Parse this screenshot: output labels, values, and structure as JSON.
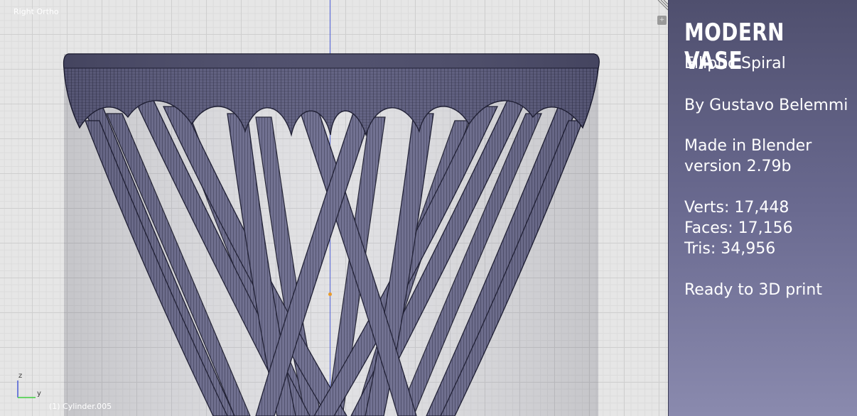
{
  "viewport": {
    "view_name": "Right Ortho",
    "object_name": "(1) Cylinder.005",
    "axis_labels": {
      "z": "z",
      "y": "y"
    }
  },
  "info": {
    "title": "MODERN VASE",
    "subtitle": "Elliptic Spiral",
    "author": "By Gustavo Belemmi",
    "made_in": "Made in Blender",
    "version": "version 2.79b",
    "verts": "Verts: 17,448",
    "faces": "Faces: 17,156",
    "tris": "Tris: 34,956",
    "ready": "Ready to 3D print"
  },
  "colors": {
    "panel_gradient_top": "#4f4f6e",
    "panel_gradient_bottom": "#8a8aae",
    "mesh_fill": "#6c6c8c",
    "mesh_wire": "#1e1e2e",
    "z_axis": "#4a5cd6",
    "y_axis": "#3fcf3f"
  },
  "icons": [
    "axis-gizmo-icon",
    "corner-split-icon",
    "view-options-icon"
  ]
}
